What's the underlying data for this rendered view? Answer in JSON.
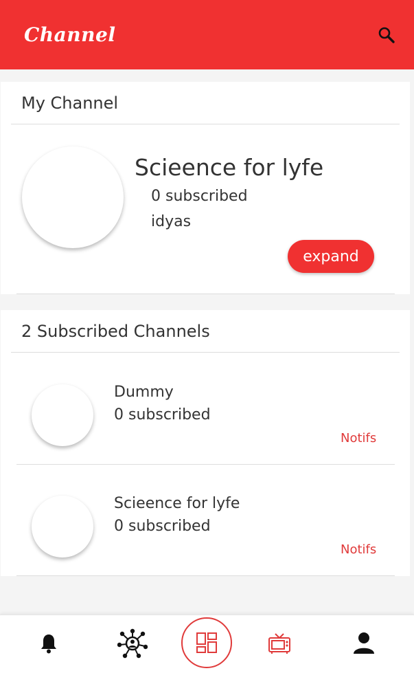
{
  "app": {
    "title": "Channel"
  },
  "colors": {
    "accent": "#f03131",
    "notif": "#e03a3a"
  },
  "my_channel": {
    "section_title": "My Channel",
    "name": "Scieence for lyfe",
    "subscribers": "0 subscribed",
    "username": "idyas",
    "expand_label": "expand"
  },
  "subscribed": {
    "section_title": "2 Subscribed Channels",
    "channels": [
      {
        "name": "Dummy",
        "subscribers": "0 subscribed",
        "notifs_label": "Notifs"
      },
      {
        "name": "Scieence for lyfe",
        "subscribers": "0 subscribed",
        "notifs_label": "Notifs"
      }
    ]
  },
  "bottom_nav": {
    "items": [
      {
        "icon": "bell-icon"
      },
      {
        "icon": "network-icon"
      },
      {
        "icon": "dashboard-icon"
      },
      {
        "icon": "tv-icon"
      },
      {
        "icon": "profile-icon"
      }
    ]
  }
}
